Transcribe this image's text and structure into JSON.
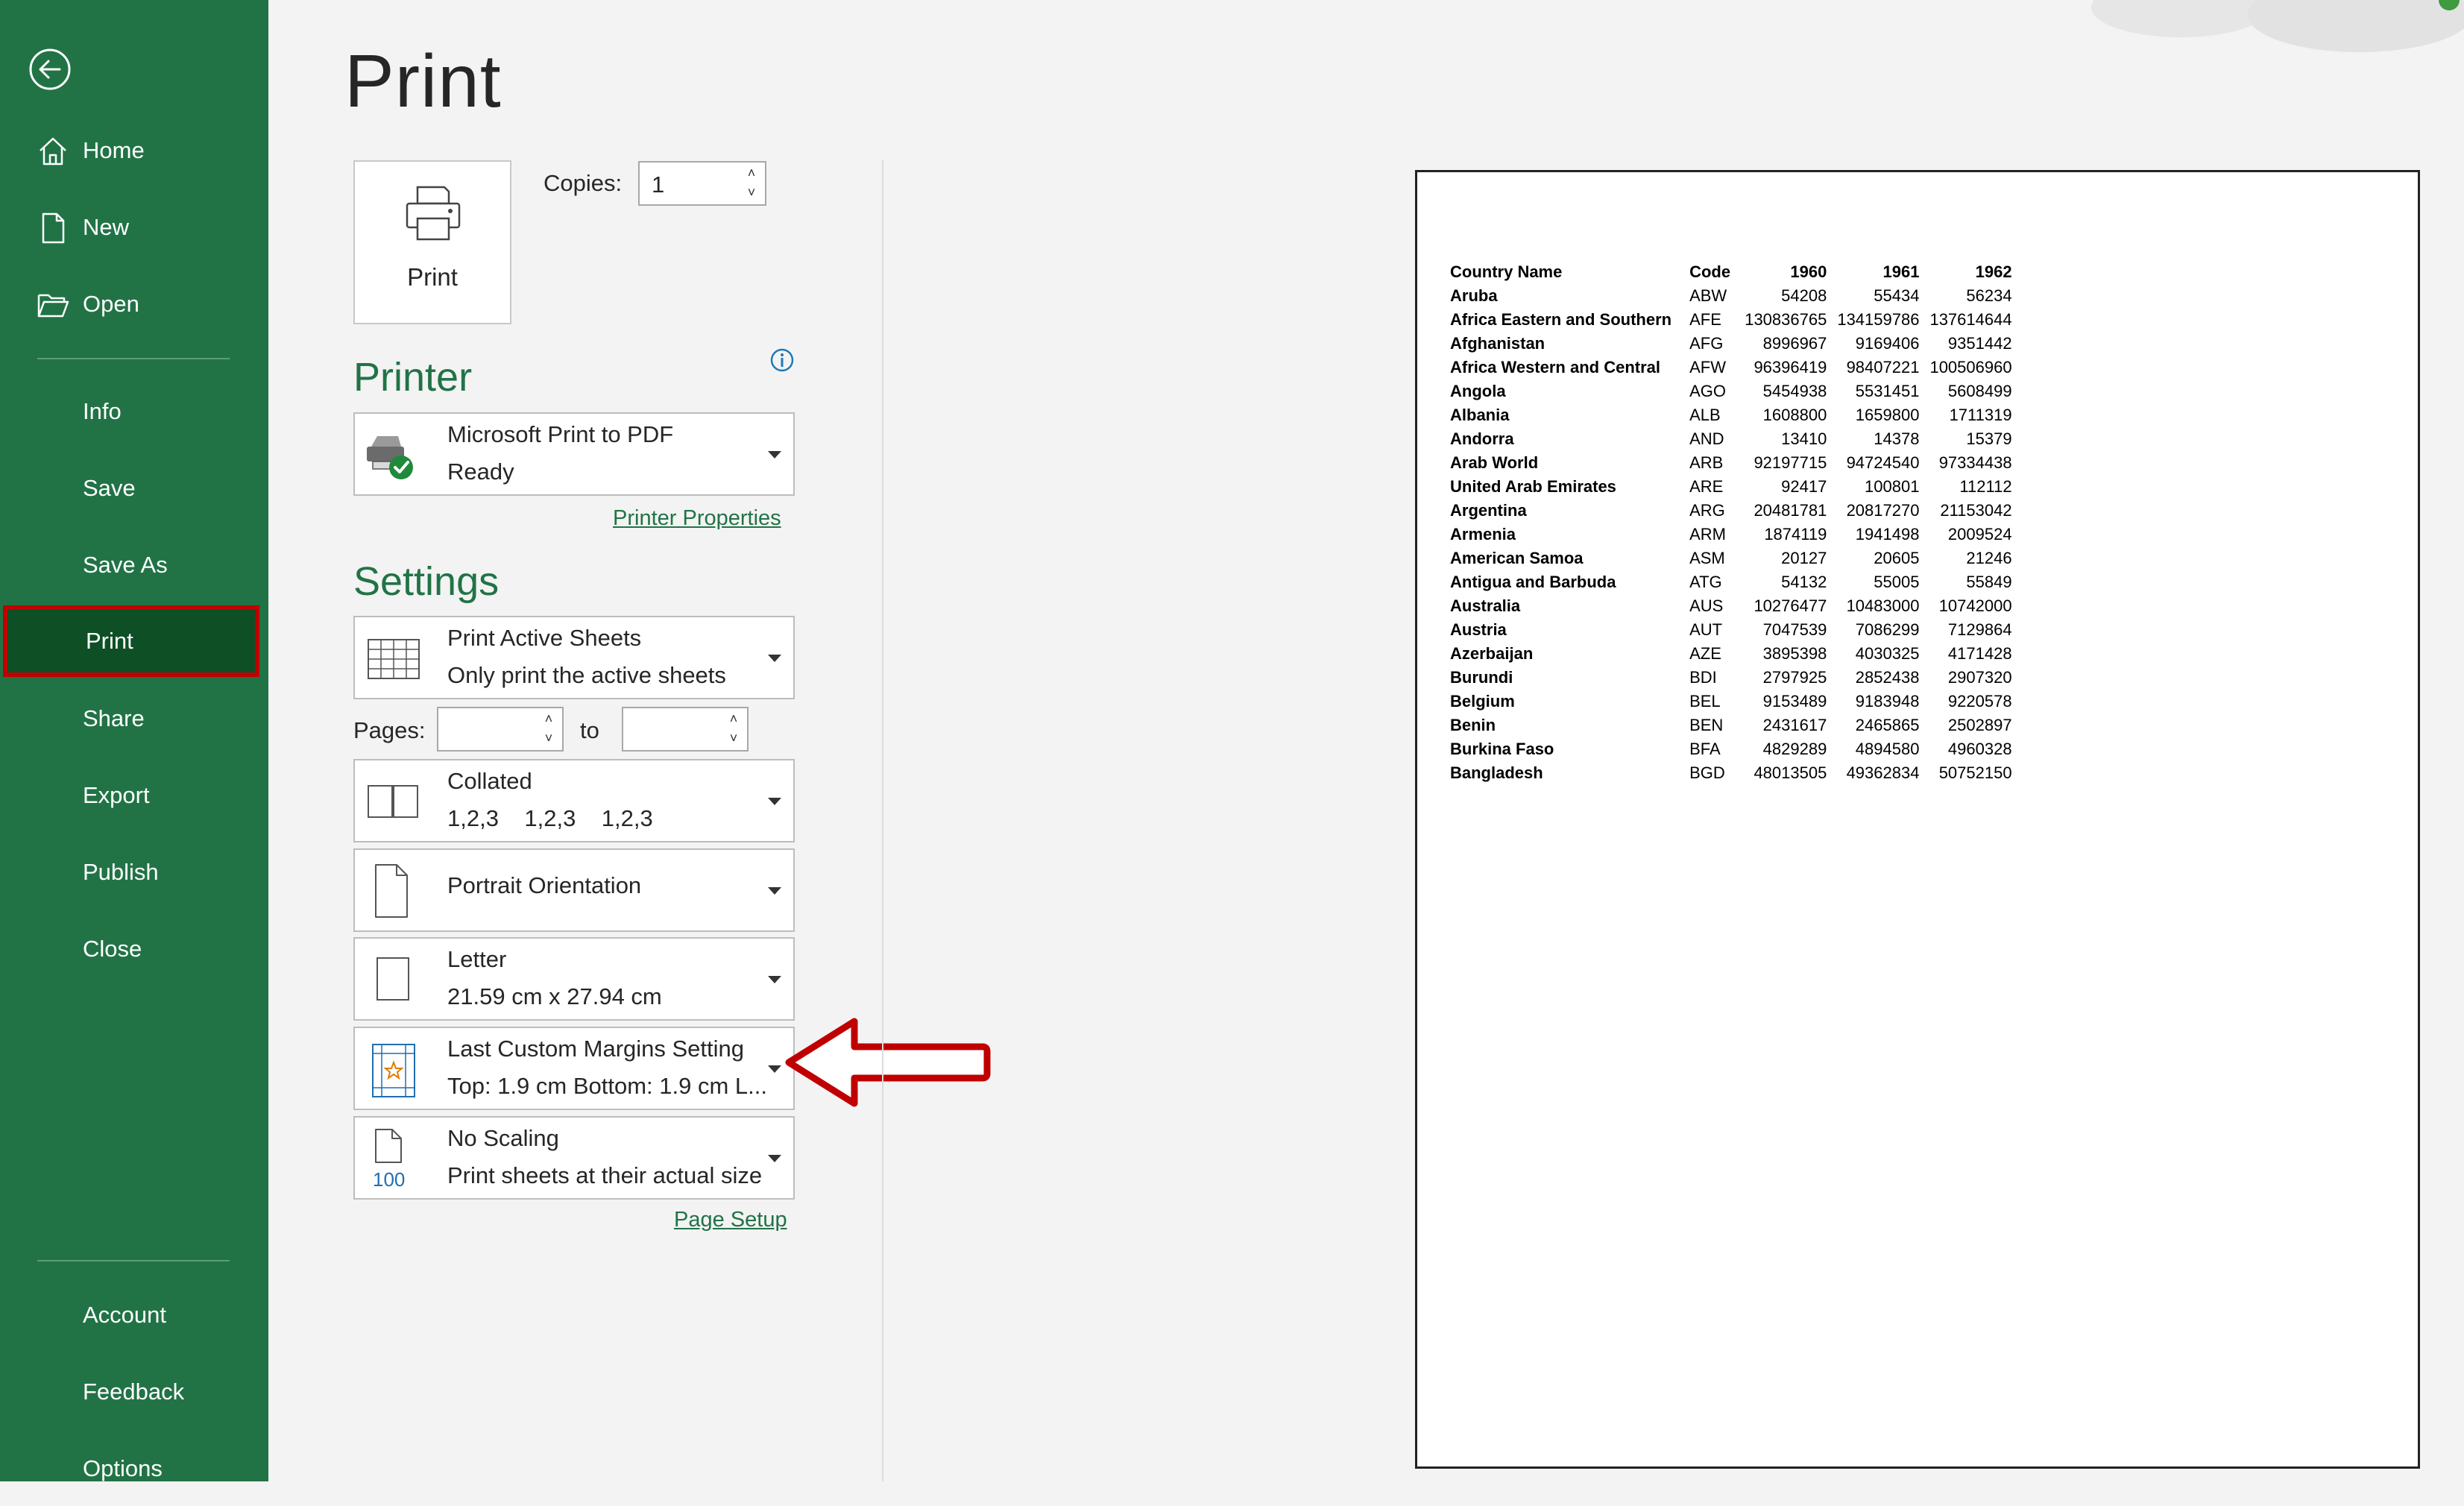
{
  "sidebar": {
    "items": [
      {
        "label": "Home"
      },
      {
        "label": "New"
      },
      {
        "label": "Open"
      },
      {
        "label": "Info"
      },
      {
        "label": "Save"
      },
      {
        "label": "Save As"
      },
      {
        "label": "Print"
      },
      {
        "label": "Share"
      },
      {
        "label": "Export"
      },
      {
        "label": "Publish"
      },
      {
        "label": "Close"
      },
      {
        "label": "Account"
      },
      {
        "label": "Feedback"
      },
      {
        "label": "Options"
      }
    ],
    "selected": "Print",
    "accent": "#217346",
    "selected_bg": "#0e4f26",
    "highlight_border": "#c00000"
  },
  "main": {
    "title": "Print",
    "print_button_label": "Print",
    "copies_label": "Copies:",
    "copies_value": "1",
    "printer_heading": "Printer",
    "printer": {
      "name": "Microsoft Print to PDF",
      "status": "Ready",
      "icon": "printer-ready-icon"
    },
    "printer_properties_link": "Printer Properties",
    "settings_heading": "Settings",
    "settings": {
      "active_sheets": {
        "title": "Print Active Sheets",
        "subtitle": "Only print the active sheets"
      },
      "pages_label": "Pages:",
      "to_label": "to",
      "collated": {
        "title": "Collated",
        "subtitle": "1,2,3    1,2,3    1,2,3"
      },
      "orientation": {
        "title": "Portrait Orientation"
      },
      "paper": {
        "title": "Letter",
        "subtitle": "21.59 cm x 27.94 cm"
      },
      "margins": {
        "title": "Last Custom Margins Setting",
        "subtitle": "Top: 1.9 cm Bottom: 1.9 cm L..."
      },
      "scaling": {
        "title": "No Scaling",
        "subtitle": "Print sheets at their actual size",
        "icon_text": "100"
      }
    },
    "page_setup_link": "Page Setup"
  },
  "preview": {
    "headers": [
      "Country Name",
      "Code",
      "1960",
      "1961",
      "1962"
    ],
    "rows": [
      [
        "Aruba",
        "ABW",
        "54208",
        "55434",
        "56234"
      ],
      [
        "Africa Eastern and Southern",
        "AFE",
        "130836765",
        "134159786",
        "137614644"
      ],
      [
        "Afghanistan",
        "AFG",
        "8996967",
        "9169406",
        "9351442"
      ],
      [
        "Africa Western and Central",
        "AFW",
        "96396419",
        "98407221",
        "100506960"
      ],
      [
        "Angola",
        "AGO",
        "5454938",
        "5531451",
        "5608499"
      ],
      [
        "Albania",
        "ALB",
        "1608800",
        "1659800",
        "1711319"
      ],
      [
        "Andorra",
        "AND",
        "13410",
        "14378",
        "15379"
      ],
      [
        "Arab World",
        "ARB",
        "92197715",
        "94724540",
        "97334438"
      ],
      [
        "United Arab Emirates",
        "ARE",
        "92417",
        "100801",
        "112112"
      ],
      [
        "Argentina",
        "ARG",
        "20481781",
        "20817270",
        "21153042"
      ],
      [
        "Armenia",
        "ARM",
        "1874119",
        "1941498",
        "2009524"
      ],
      [
        "American Samoa",
        "ASM",
        "20127",
        "20605",
        "21246"
      ],
      [
        "Antigua and Barbuda",
        "ATG",
        "54132",
        "55005",
        "55849"
      ],
      [
        "Australia",
        "AUS",
        "10276477",
        "10483000",
        "10742000"
      ],
      [
        "Austria",
        "AUT",
        "7047539",
        "7086299",
        "7129864"
      ],
      [
        "Azerbaijan",
        "AZE",
        "3895398",
        "4030325",
        "4171428"
      ],
      [
        "Burundi",
        "BDI",
        "2797925",
        "2852438",
        "2907320"
      ],
      [
        "Belgium",
        "BEL",
        "9153489",
        "9183948",
        "9220578"
      ],
      [
        "Benin",
        "BEN",
        "2431617",
        "2465865",
        "2502897"
      ],
      [
        "Burkina Faso",
        "BFA",
        "4829289",
        "4894580",
        "4960328"
      ],
      [
        "Bangladesh",
        "BGD",
        "48013505",
        "49362834",
        "50752150"
      ]
    ]
  },
  "annotation": {
    "color": "#c00000"
  }
}
